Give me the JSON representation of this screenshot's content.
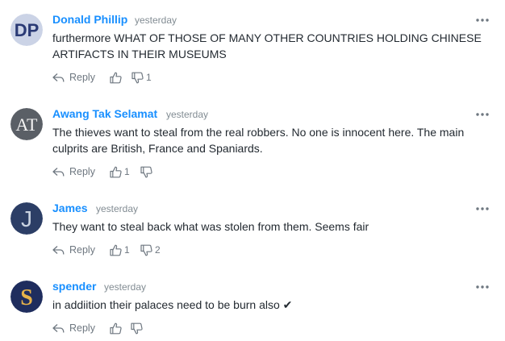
{
  "comments": [
    {
      "author": "Donald Phillip",
      "time": "yesterday",
      "avatar_initials": "DP",
      "avatar_bg": "#cbd3e6",
      "avatar_fg": "#2a3a75",
      "text": "furthermore WHAT OF THOSE OF MANY OTHER COUNTRIES HOLDING CHINESE ARTIFACTS IN THEIR MUSEUMS",
      "reply_label": "Reply",
      "thumbs_up": "",
      "thumbs_down": "1"
    },
    {
      "author": "Awang Tak Selamat",
      "time": "yesterday",
      "avatar_initials": "AT",
      "avatar_bg": "#5a5f66",
      "avatar_fg": "#f2f2f2",
      "text": "The thieves want to steal from the real robbers. No one is innocent here. The main culprits are British, France and Spaniards.",
      "reply_label": "Reply",
      "thumbs_up": "1",
      "thumbs_down": ""
    },
    {
      "author": "James",
      "time": "yesterday",
      "avatar_initials": "J",
      "avatar_bg": "#2c3e66",
      "avatar_fg": "#c9d2e0",
      "text": "They want to steal back what was stolen from them. Seems fair",
      "reply_label": "Reply",
      "thumbs_up": "1",
      "thumbs_down": "2"
    },
    {
      "author": "spender",
      "time": "yesterday",
      "avatar_initials": "S",
      "avatar_bg": "#1f2d5e",
      "avatar_fg": "#e7b24a",
      "text": "in addiition their palaces need to be burn also ✔",
      "reply_label": "Reply",
      "thumbs_up": "",
      "thumbs_down": ""
    }
  ],
  "colors": {
    "author": "#188fff",
    "meta": "#828c93",
    "text": "#232a31",
    "action": "#6e7780"
  },
  "icons": {
    "more": "more-dots-icon",
    "reply": "reply-arrow-icon",
    "up": "thumbs-up-icon",
    "down": "thumbs-down-icon"
  }
}
